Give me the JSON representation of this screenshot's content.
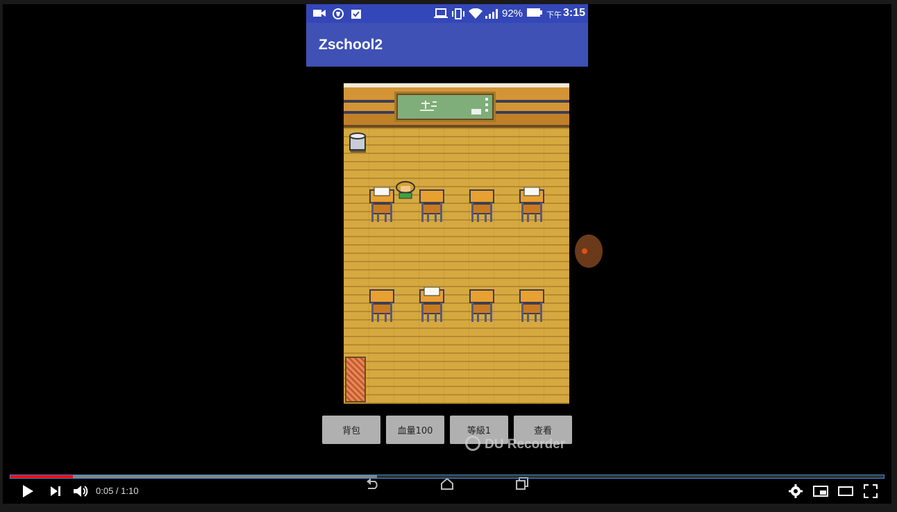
{
  "status_bar": {
    "battery": "92%",
    "time_prefix": "下午",
    "time": "3:15"
  },
  "app": {
    "title": "Zschool2"
  },
  "game_buttons": [
    {
      "label": "背包"
    },
    {
      "label": "血量100"
    },
    {
      "label": "等級1"
    },
    {
      "label": "查看"
    }
  ],
  "watermark": {
    "text": "DU Recorder"
  },
  "player": {
    "time_display": "0:05 / 1:10",
    "played_fraction": 0.0714,
    "buffered_fraction": 0.42,
    "accent_color": "#ff0000"
  },
  "icons": {
    "status": [
      "video-camera-icon",
      "vpn-shield-icon",
      "clipboard-check-icon",
      "laptop-icon",
      "vibrate-icon",
      "wifi-icon",
      "signal-icon",
      "battery-icon"
    ],
    "nav": [
      "back-icon",
      "home-icon",
      "recents-icon"
    ],
    "controls": [
      "play-icon",
      "next-icon",
      "volume-icon",
      "settings-icon",
      "miniplayer-icon",
      "theater-icon",
      "fullscreen-icon"
    ]
  }
}
